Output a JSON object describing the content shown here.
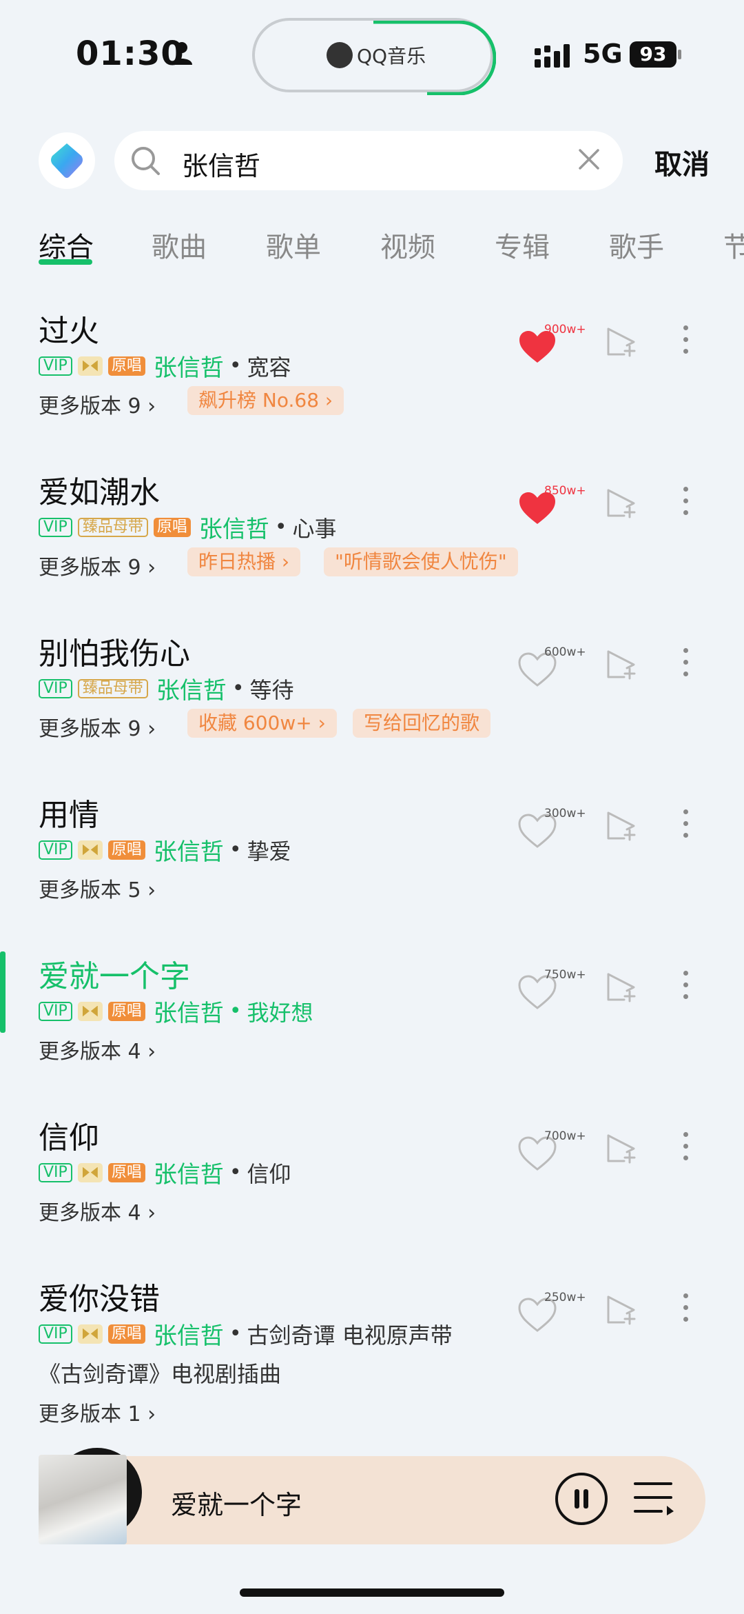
{
  "status": {
    "time": "01:30",
    "network": "5G",
    "battery": "93"
  },
  "now_playing_island": {
    "app": "QQ音乐"
  },
  "search": {
    "query": "张信哲",
    "cancel": "取消"
  },
  "tabs": [
    "综合",
    "歌曲",
    "歌单",
    "视频",
    "专辑",
    "歌手",
    "节"
  ],
  "active_tab": "综合",
  "tag_labels": {
    "vip": "VIP",
    "master": "臻品母带",
    "original": "原唱"
  },
  "songs": [
    {
      "title": "过火",
      "artist": "张信哲",
      "album": "宽容",
      "versions": "更多版本 9",
      "likes": "900w+",
      "liked": true,
      "chips": [
        "飙升榜 No.68 ›"
      ]
    },
    {
      "title": "爱如潮水",
      "artist": "张信哲",
      "album": "心事",
      "versions": "更多版本 9",
      "likes": "850w+",
      "liked": true,
      "chips": [
        "昨日热播 ›",
        "\"听情歌会使人忧伤\""
      ]
    },
    {
      "title": "别怕我伤心",
      "artist": "张信哲",
      "album": "等待",
      "versions": "更多版本 9",
      "likes": "600w+",
      "liked": false,
      "chips": [
        "收藏 600w+ ›",
        "写给回忆的歌"
      ]
    },
    {
      "title": "用情",
      "artist": "张信哲",
      "album": "挚爱",
      "versions": "更多版本 5",
      "likes": "300w+",
      "liked": false,
      "chips": []
    },
    {
      "title": "爱就一个字",
      "artist": "张信哲",
      "album": "我好想",
      "versions": "更多版本 4",
      "likes": "750w+",
      "liked": false,
      "playing": true,
      "chips": []
    },
    {
      "title": "信仰",
      "artist": "张信哲",
      "album": "信仰",
      "versions": "更多版本 4",
      "likes": "700w+",
      "liked": false,
      "chips": []
    },
    {
      "title": "爱你没错",
      "artist": "张信哲",
      "album": "古剑奇谭 电视原声带",
      "extra": "《古剑奇谭》电视剧插曲",
      "versions": "更多版本 1",
      "likes": "250w+",
      "liked": false,
      "chips": []
    }
  ],
  "player": {
    "title": "爱就一个字"
  },
  "colors": {
    "accent": "#16c06a",
    "like": "#ef3340",
    "chip_bg": "#f8e2d4",
    "chip_text": "#f08640",
    "original_tag": "#f08e3a"
  }
}
